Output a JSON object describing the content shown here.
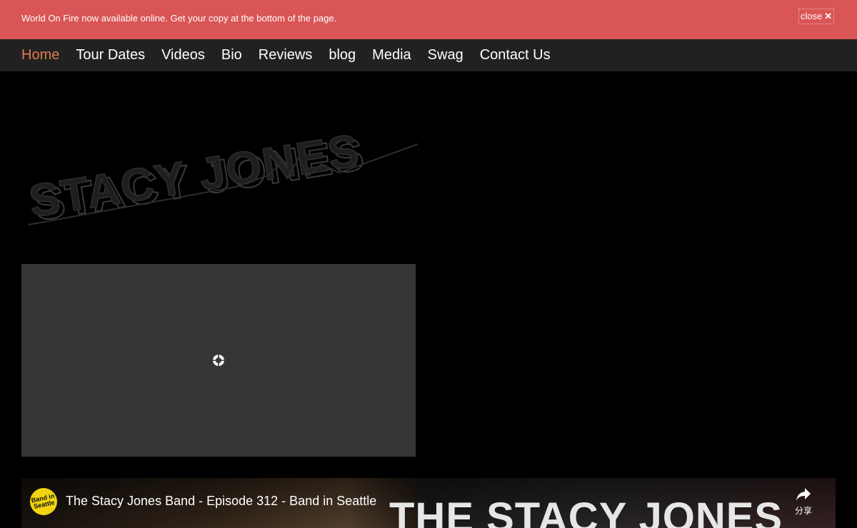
{
  "banner": {
    "message": "World On Fire now available online. Get your copy at the bottom of the page.",
    "close_label": "close",
    "close_glyph": "✕"
  },
  "nav": {
    "items": [
      {
        "label": "Home",
        "active": true
      },
      {
        "label": "Tour Dates"
      },
      {
        "label": "Videos"
      },
      {
        "label": "Bio"
      },
      {
        "label": "Reviews"
      },
      {
        "label": "blog"
      },
      {
        "label": "Media"
      },
      {
        "label": "Swag"
      },
      {
        "label": "Contact Us"
      }
    ]
  },
  "logo": {
    "text": "STACY JONES"
  },
  "video": {
    "channel_badge": "Band in Seattle",
    "title": "The Stacy Jones Band - Episode 312 - Band in Seattle",
    "thumbnail_text": "THE STACY JONES",
    "share_label": "分享"
  },
  "colors": {
    "banner_bg": "#d95556",
    "nav_bg": "#212121",
    "nav_active": "#e07a4b",
    "page_bg": "#000000",
    "placeholder_bg": "#363636"
  }
}
